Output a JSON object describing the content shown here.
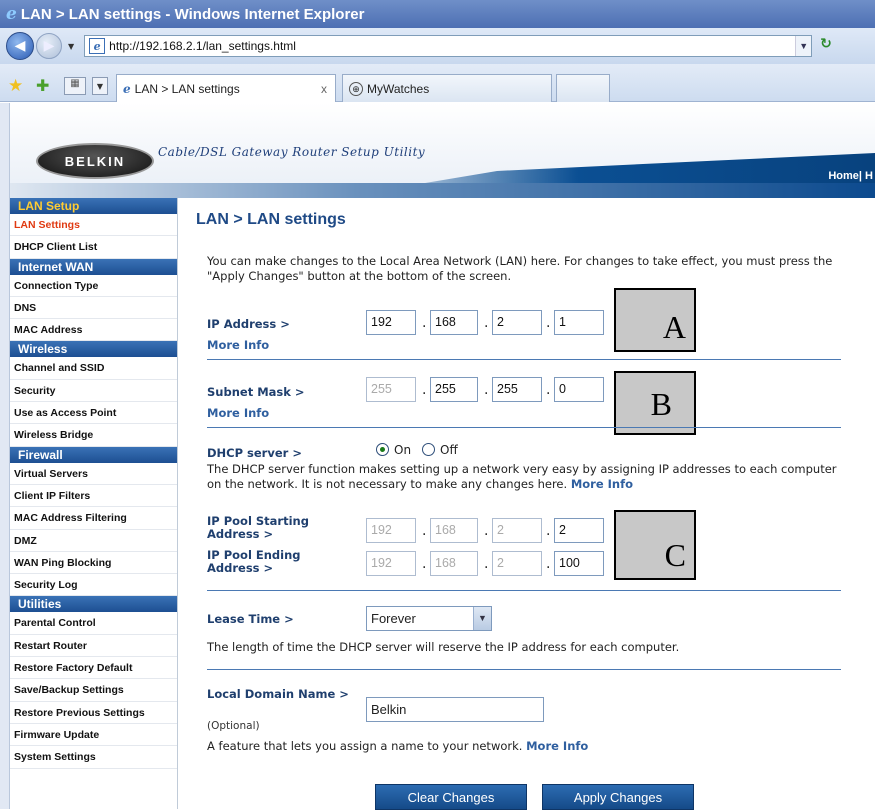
{
  "window": {
    "title": "LAN > LAN settings - Windows Internet Explorer"
  },
  "browser": {
    "url": "http://192.168.2.1/lan_settings.html",
    "tabs": [
      {
        "label": "LAN > LAN settings",
        "close": "x"
      },
      {
        "label": "MyWatches"
      }
    ]
  },
  "header": {
    "logo_text": "BELKIN",
    "tagline": "Cable/DSL Gateway Router Setup Utility",
    "home_link": "Home| H"
  },
  "sidebar": {
    "sections": [
      {
        "title": "LAN Setup",
        "items": [
          "LAN Settings",
          "DHCP Client List"
        ]
      },
      {
        "title": "Internet WAN",
        "items": [
          "Connection Type",
          "DNS",
          "MAC Address"
        ]
      },
      {
        "title": "Wireless",
        "items": [
          "Channel and SSID",
          "Security",
          "Use as Access Point",
          "Wireless Bridge"
        ]
      },
      {
        "title": "Firewall",
        "items": [
          "Virtual Servers",
          "Client IP Filters",
          "MAC Address Filtering",
          "DMZ",
          "WAN Ping Blocking",
          "Security Log"
        ]
      },
      {
        "title": "Utilities",
        "items": [
          "Parental Control",
          "Restart Router",
          "Restore Factory Default",
          "Save/Backup Settings",
          "Restore Previous Settings",
          "Firmware Update",
          "System Settings"
        ]
      }
    ]
  },
  "main": {
    "title": "LAN > LAN settings",
    "intro": "You can make changes to the Local Area Network (LAN) here. For changes to take effect, you must press the \"Apply Changes\" button at the bottom of the screen.",
    "ip_address": {
      "label": "IP Address >",
      "more_info": "More Info",
      "octets": [
        "192",
        "168",
        "2",
        "1"
      ]
    },
    "subnet_mask": {
      "label": "Subnet Mask >",
      "more_info": "More Info",
      "octets": [
        "255",
        "255",
        "255",
        "0"
      ]
    },
    "dhcp": {
      "label": "DHCP server >",
      "on": "On",
      "off": "Off",
      "selected": "On",
      "description": "The DHCP server function makes setting up a network very easy by assigning IP addresses to each computer on the network. It is not necessary to make any changes here.",
      "more_info": "More Info"
    },
    "pool_start": {
      "label": "IP Pool Starting Address >",
      "octets": [
        "192",
        "168",
        "2",
        "2"
      ]
    },
    "pool_end": {
      "label": "IP Pool Ending Address >",
      "octets": [
        "192",
        "168",
        "2",
        "100"
      ]
    },
    "lease_time": {
      "label": "Lease Time >",
      "value": "Forever",
      "description": "The length of time the DHCP server will reserve the IP address for each computer."
    },
    "domain": {
      "label": "Local Domain Name >",
      "optional": "(Optional)",
      "value": "Belkin",
      "description": "A feature that lets you assign a name to your network.",
      "more_info": "More Info"
    },
    "buttons": {
      "clear": "Clear Changes",
      "apply": "Apply Changes"
    }
  },
  "annotations": [
    "A",
    "B",
    "C"
  ]
}
